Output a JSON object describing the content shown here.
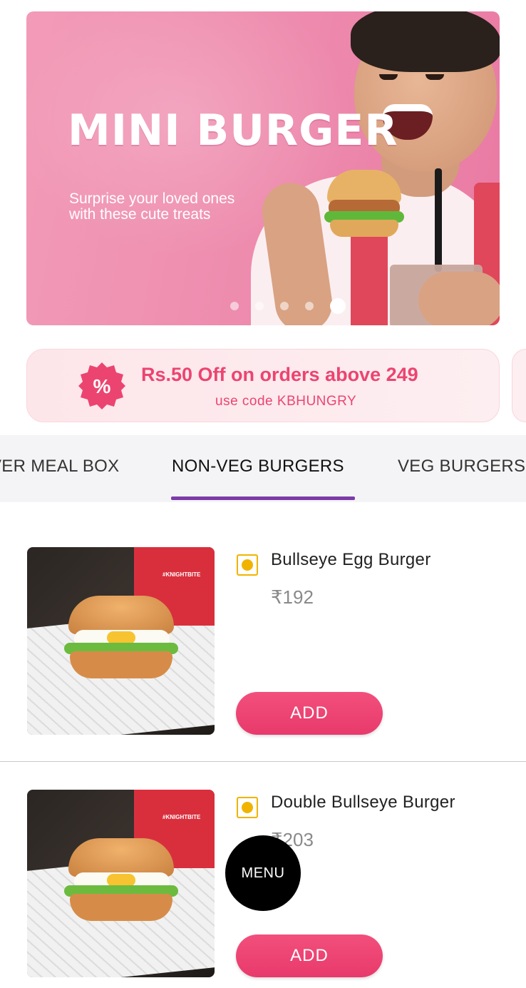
{
  "banner": {
    "title": "MINI BURGER",
    "subtitle_line1": "Surprise your loved ones",
    "subtitle_line2": "with these cute treats",
    "carousel_count": 6,
    "carousel_active_index": 5
  },
  "offer": {
    "badge_symbol": "%",
    "title": "Rs.50 Off on orders above 249",
    "code_text": "use code KBHUNGRY",
    "accent_color": "#ec4470"
  },
  "tabs": {
    "items": [
      {
        "label": "VER MEAL BOX"
      },
      {
        "label": "NON-VEG BURGERS"
      },
      {
        "label": "VEG BURGERS"
      }
    ],
    "active_index": 1,
    "active_color": "#7b3ca8"
  },
  "products": [
    {
      "name": "Bullseye Egg Burger",
      "price": "₹192",
      "add_label": "ADD",
      "image_box_text": "#KNIGHTBITE",
      "diet_icon": "egg-indicator-icon"
    },
    {
      "name": "Double Bullseye Burger",
      "price": "₹203",
      "add_label": "ADD",
      "image_box_text": "#KNIGHTBITE",
      "diet_icon": "egg-indicator-icon"
    }
  ],
  "fab": {
    "label": "MENU"
  }
}
